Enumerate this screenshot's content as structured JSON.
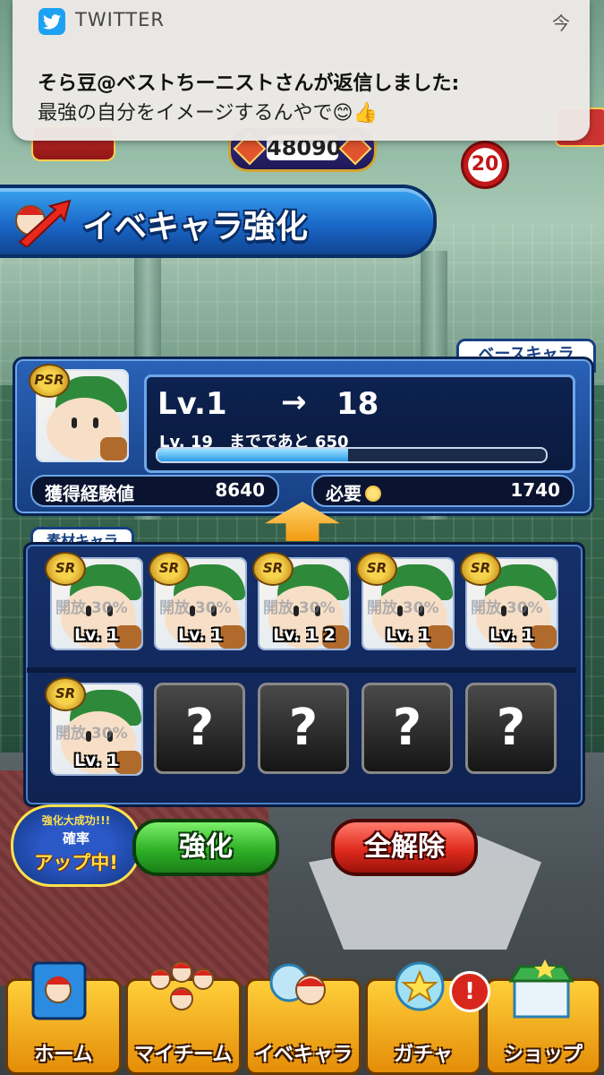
{
  "notification": {
    "app_name": "TWITTER",
    "time": "今",
    "title": "そら豆@ベストちーニストさんが返信しました:",
    "body": "最強の自分をイメージするんやで😊👍"
  },
  "hud": {
    "currency_value": "48090",
    "stamina": "20"
  },
  "screen_title": "イベキャラ強化",
  "base_character": {
    "tag": "ベースキャラ",
    "rank": "PSR",
    "level_current": "Lv.1",
    "level_arrow": "→",
    "level_target": "18",
    "next_level_text": "Lv. 19　までであと 650",
    "progress_fraction": 0.49,
    "exp_label": "獲得経験値",
    "exp_value": "8640",
    "cost_label": "必要",
    "cost_value": "1740"
  },
  "materials": {
    "tag": "素材キャラ",
    "slots": [
      {
        "rank": "SR",
        "skill": "開放 30%",
        "level": "Lv. 1"
      },
      {
        "rank": "SR",
        "skill": "開放 30%",
        "level": "Lv. 1"
      },
      {
        "rank": "SR",
        "skill": "開放 30%",
        "level": "Lv. 1 2"
      },
      {
        "rank": "SR",
        "skill": "開放 30%",
        "level": "Lv. 1"
      },
      {
        "rank": "SR",
        "skill": "開放 30%",
        "level": "Lv. 1"
      },
      {
        "rank": "SR",
        "skill": "開放 30%",
        "level": "Lv. 1"
      }
    ],
    "empty_slot_mark": "?"
  },
  "boost_badge": {
    "line1": "強化大成功!!!",
    "line2": "確率",
    "line3": "アップ中!"
  },
  "buttons": {
    "enhance": "強化",
    "clear_all": "全解除"
  },
  "nav": {
    "items": [
      {
        "label": "ホーム",
        "icon": "home-book-icon"
      },
      {
        "label": "マイチーム",
        "icon": "team-players-icon"
      },
      {
        "label": "イベキャラ",
        "icon": "event-character-icon"
      },
      {
        "label": "ガチャ",
        "icon": "gacha-ball-icon"
      },
      {
        "label": "ショップ",
        "icon": "shop-store-icon"
      }
    ],
    "alert_mark": "!"
  },
  "colors": {
    "twitter_blue": "#1da1f2",
    "title_blue": "#1b68c9",
    "enhance_green": "#2fb027",
    "clear_red": "#e02a1e",
    "nav_gold": "#ffcf3a"
  }
}
